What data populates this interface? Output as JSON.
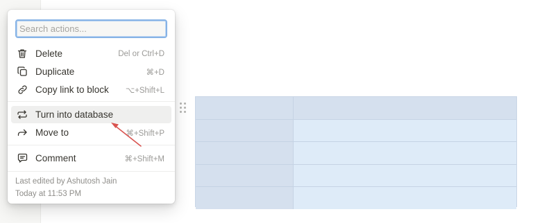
{
  "search": {
    "placeholder": "Search actions..."
  },
  "menu": {
    "items": [
      {
        "label": "Delete",
        "shortcut": "Del or Ctrl+D",
        "icon": "trash-icon"
      },
      {
        "label": "Duplicate",
        "shortcut": "⌘+D",
        "icon": "duplicate-icon"
      },
      {
        "label": "Copy link to block",
        "shortcut": "⌥+Shift+L",
        "icon": "link-icon"
      },
      {
        "label": "Turn into database",
        "shortcut": "",
        "icon": "turn-into-icon"
      },
      {
        "label": "Move to",
        "shortcut": "⌘+Shift+P",
        "icon": "arrow-right-icon"
      },
      {
        "label": "Comment",
        "shortcut": "⌘+Shift+M",
        "icon": "comment-icon"
      }
    ],
    "footer": {
      "edited_by": "Last edited by Ashutosh Jain",
      "edited_at": "Today at 11:53 PM"
    }
  },
  "colors": {
    "table_header": "#d5e0ee",
    "table_cell": "#deebf8",
    "search_border": "#86b3e6",
    "annotation_arrow": "#d9534f",
    "active_item_bg": "#efefee"
  },
  "table": {
    "rows": 5,
    "columns": 2
  }
}
